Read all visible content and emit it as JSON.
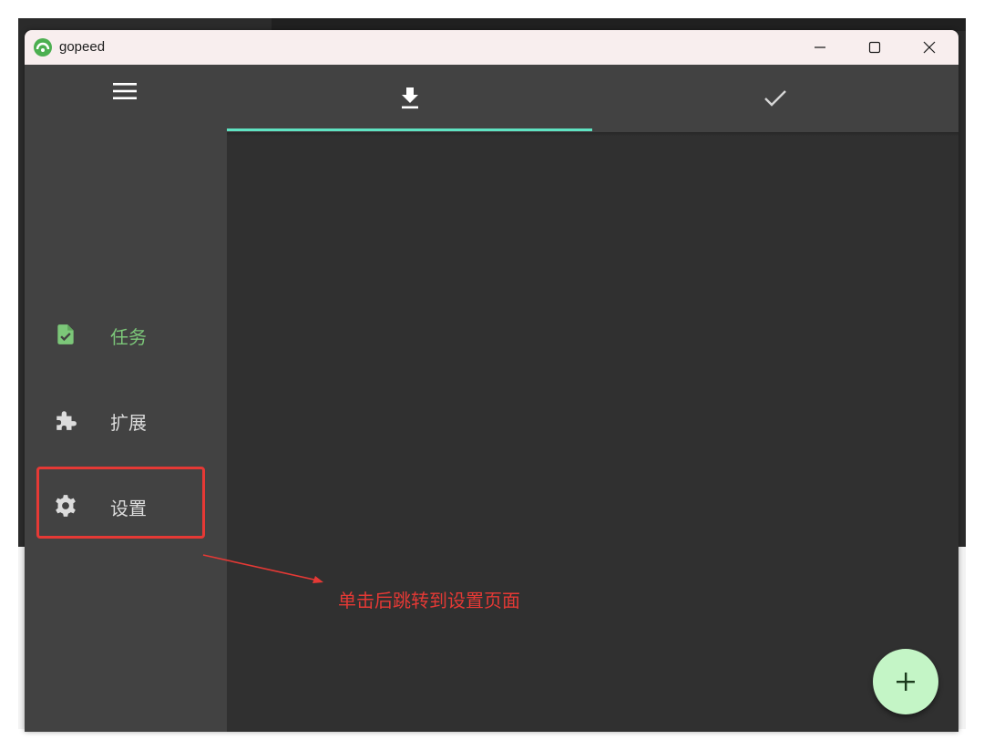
{
  "window": {
    "title": "gopeed"
  },
  "sidebar": {
    "items": [
      {
        "label": "任务",
        "icon": "task-file-check-icon",
        "active": true
      },
      {
        "label": "扩展",
        "icon": "puzzle-icon",
        "active": false
      },
      {
        "label": "设置",
        "icon": "gear-icon",
        "active": false
      }
    ]
  },
  "tabs": [
    {
      "icon": "download-icon",
      "selected": true
    },
    {
      "icon": "check-icon",
      "selected": false
    }
  ],
  "fab": {
    "icon": "plus-icon"
  },
  "annotation": {
    "text": "单击后跳转到设置页面"
  },
  "colors": {
    "accent_active": "#7cc779",
    "tab_indicator": "#5fe3c2",
    "fab": "#c4f5c6",
    "annotation": "#e53935",
    "sidebar_bg": "#424242",
    "content_bg": "#303030",
    "titlebar_bg": "#f8eeee"
  }
}
